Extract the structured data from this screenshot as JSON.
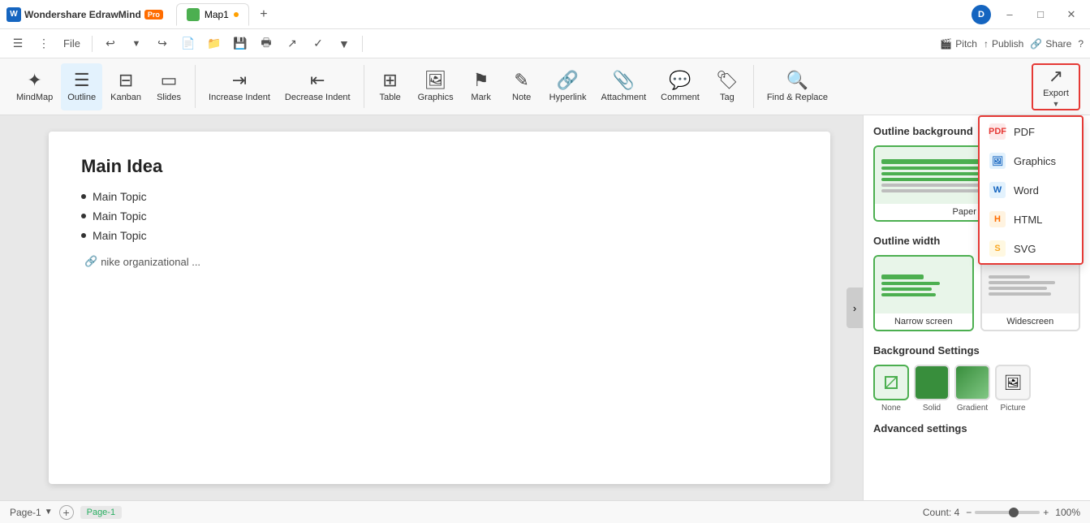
{
  "app": {
    "name": "Wondershare EdrawMind",
    "badge": "Pro",
    "tab1": "Map1",
    "user_initial": "D"
  },
  "toolbar": {
    "file": "File",
    "undo": "↩",
    "redo": "↪"
  },
  "ribbon": {
    "mindmap": "MindMap",
    "outline": "Outline",
    "kanban": "Kanban",
    "slides": "Slides",
    "increase_indent": "Increase Indent",
    "decrease_indent": "Decrease Indent",
    "table": "Table",
    "graphics": "Graphics",
    "mark": "Mark",
    "note": "Note",
    "hyperlink": "Hyperlink",
    "attachment": "Attachment",
    "comment": "Comment",
    "tag": "Tag",
    "find_replace": "Find & Replace",
    "export": "Export",
    "pitch": "Pitch",
    "publish": "Publish",
    "share": "Share"
  },
  "canvas": {
    "title": "Main Idea",
    "items": [
      "Main Topic",
      "Main Topic",
      "Main Topic"
    ],
    "link_text": "nike organizational ..."
  },
  "right_panel": {
    "outline_background_title": "Outline background",
    "paper_mode_label": "Paper mode",
    "outline_width_title": "Outline width",
    "narrow_screen_label": "Narrow screen",
    "widescreen_label": "Widescreen",
    "background_settings_title": "Background Settings",
    "bg_none_label": "None",
    "bg_solid_label": "Solid",
    "bg_gradient_label": "Gradient",
    "bg_picture_label": "Picture",
    "advanced_settings_title": "Advanced settings"
  },
  "export_dropdown": {
    "options": [
      {
        "id": "pdf",
        "label": "PDF",
        "icon": "📄",
        "color": "#e53935"
      },
      {
        "id": "graphics",
        "label": "Graphics",
        "icon": "🖼",
        "color": "#2196f3"
      },
      {
        "id": "word",
        "label": "Word",
        "icon": "W",
        "color": "#1565c0"
      },
      {
        "id": "html",
        "label": "HTML",
        "icon": "H",
        "color": "#ff6d00"
      },
      {
        "id": "svg",
        "label": "SVG",
        "icon": "S",
        "color": "#ffc107"
      }
    ]
  },
  "status_bar": {
    "page": "Page-1",
    "page_tab": "Page-1",
    "count": "Count: 4",
    "zoom": "100%"
  }
}
